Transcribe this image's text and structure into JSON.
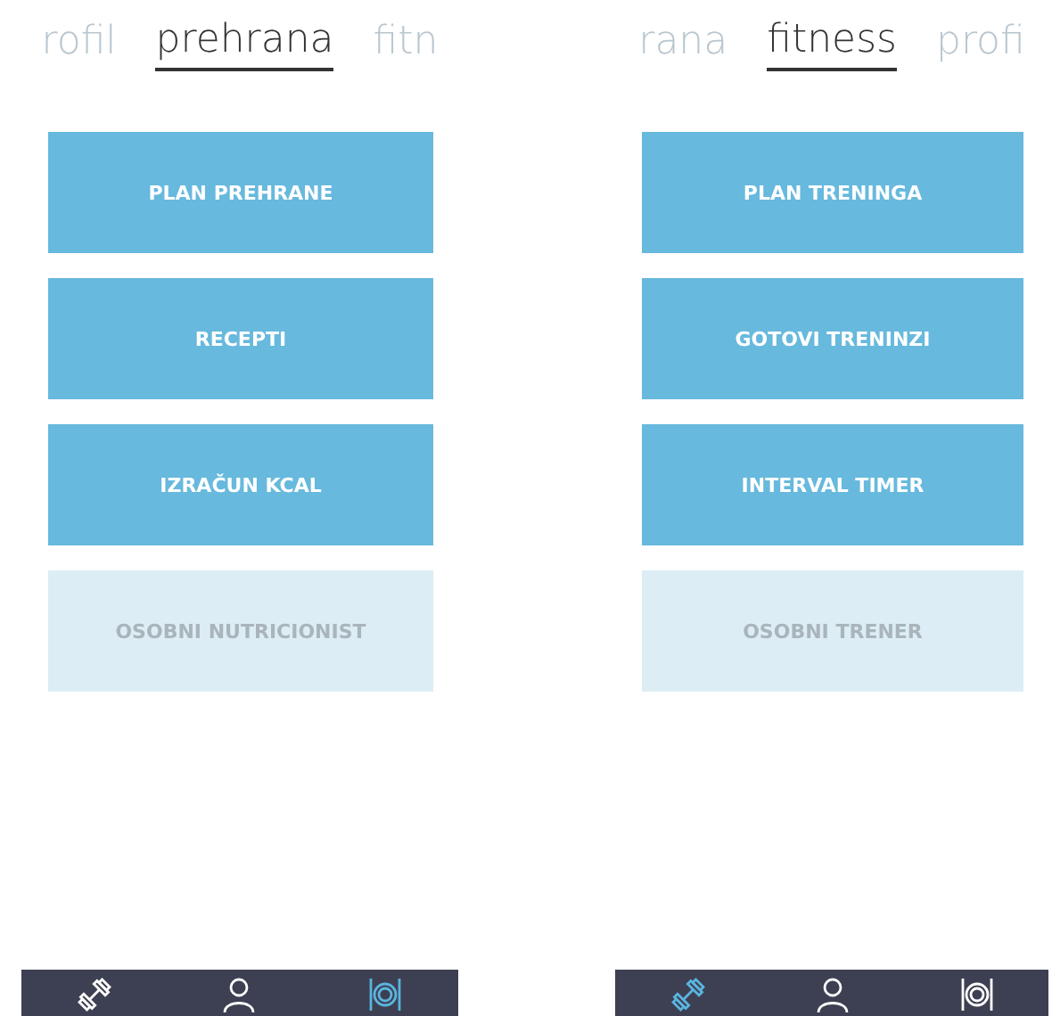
{
  "screens": [
    {
      "tabs": [
        {
          "label": "rofil",
          "selected": false
        },
        {
          "label": "prehrana",
          "selected": true
        },
        {
          "label": "fitn",
          "selected": false
        }
      ],
      "buttons": [
        {
          "label": "PLAN PREHRANE",
          "disabled": false
        },
        {
          "label": "RECEPTI",
          "disabled": false
        },
        {
          "label": "IZRAČUN KCAL",
          "disabled": false
        },
        {
          "label": "OSOBNI NUTRICIONIST",
          "disabled": true
        }
      ],
      "nav": [
        {
          "kind": "fitness",
          "selected": false
        },
        {
          "kind": "profile",
          "selected": false
        },
        {
          "kind": "nutrition",
          "selected": true
        }
      ]
    },
    {
      "tabs": [
        {
          "label": "rana",
          "selected": false
        },
        {
          "label": "fitness",
          "selected": true
        },
        {
          "label": "profi",
          "selected": false
        }
      ],
      "buttons": [
        {
          "label": "PLAN TRENINGA",
          "disabled": false
        },
        {
          "label": "GOTOVI TRENINZI",
          "disabled": false
        },
        {
          "label": "INTERVAL TIMER",
          "disabled": false
        },
        {
          "label": "OSOBNI TRENER",
          "disabled": true
        }
      ],
      "nav": [
        {
          "kind": "fitness",
          "selected": true
        },
        {
          "kind": "profile",
          "selected": false
        },
        {
          "kind": "nutrition",
          "selected": false
        }
      ]
    }
  ]
}
